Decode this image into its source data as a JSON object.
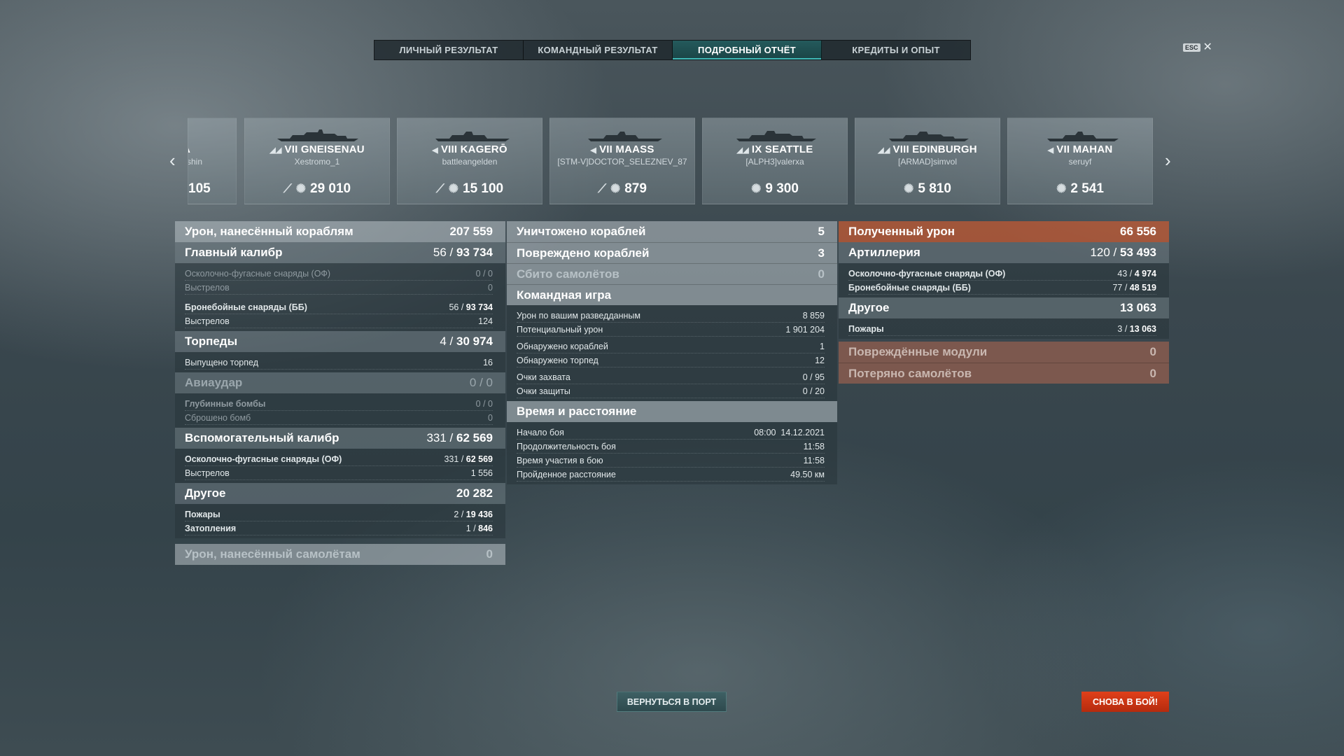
{
  "tabs": [
    "ЛИЧНЫЙ РЕЗУЛЬТАТ",
    "КОМАНДНЫЙ РЕЗУЛЬТАТ",
    "ПОДРОБНЫЙ ОТЧЁТ",
    "КРЕДИТЫ И ОПЫТ"
  ],
  "active_tab": "ПОДРОБНЫЙ ОТЧЁТ",
  "esc_label": "ESC",
  "ships": [
    {
      "name": "A",
      "player": "shin",
      "value": "105",
      "partial": true
    },
    {
      "name": "VII GNEISENAU",
      "player": "Xestromo_1",
      "value": "29 010"
    },
    {
      "name": "VIII KAGERŌ",
      "player": "battleangelden",
      "value": "15 100"
    },
    {
      "name": "VII MAASS",
      "player": "[STM-V]DOCTOR_SELEZNEV_87",
      "value": "879"
    },
    {
      "name": "IX SEATTLE",
      "player": "[ALPH3]valerxa",
      "value": "9 300"
    },
    {
      "name": "VIII EDINBURGH",
      "player": "[ARMAD]simvol",
      "value": "5 810"
    },
    {
      "name": "VII MAHAN",
      "player": "seruyf",
      "value": "2 541"
    }
  ],
  "left": {
    "damage_header": {
      "label": "Урон, нанесённый кораблям",
      "value": "207 559"
    },
    "main_caliber": {
      "label": "Главный калибр",
      "hits": "56",
      "dmg": "93 734"
    },
    "he_shells": {
      "label": "Осколочно-фугасные снаряды (ОФ)",
      "hits": "0",
      "dmg": "0"
    },
    "he_shots": {
      "label": "Выстрелов",
      "value": "0"
    },
    "ap_shells": {
      "label": "Бронебойные снаряды (ББ)",
      "hits": "56",
      "dmg": "93 734"
    },
    "ap_shots": {
      "label": "Выстрелов",
      "value": "124"
    },
    "torpedoes": {
      "label": "Торпеды",
      "hits": "4",
      "dmg": "30 974"
    },
    "torps_launched": {
      "label": "Выпущено торпед",
      "value": "16"
    },
    "airstrike": {
      "label": "Авиаудар",
      "hits": "0",
      "dmg": "0"
    },
    "depth_charges": {
      "label": "Глубинные бомбы",
      "hits": "0",
      "dmg": "0"
    },
    "bombs_dropped": {
      "label": "Сброшено бомб",
      "value": "0"
    },
    "secondary": {
      "label": "Вспомогательный калибр",
      "hits": "331",
      "dmg": "62 569"
    },
    "sec_he": {
      "label": "Осколочно-фугасные снаряды (ОФ)",
      "hits": "331",
      "dmg": "62 569"
    },
    "sec_shots": {
      "label": "Выстрелов",
      "value": "1 556"
    },
    "other": {
      "label": "Другое",
      "value": "20 282"
    },
    "fires": {
      "label": "Пожары",
      "hits": "2",
      "dmg": "19 436"
    },
    "floods": {
      "label": "Затопления",
      "hits": "1",
      "dmg": "846"
    },
    "plane_damage": {
      "label": "Урон, нанесённый самолётам",
      "value": "0"
    }
  },
  "middle": {
    "destroyed": {
      "label": "Уничтожено кораблей",
      "value": "5"
    },
    "damaged": {
      "label": "Повреждено кораблей",
      "value": "3"
    },
    "planes_shot": {
      "label": "Сбито самолётов",
      "value": "0"
    },
    "team_play": {
      "label": "Командная игра"
    },
    "spot_damage": {
      "label": "Урон по вашим разведданным",
      "value": "8 859"
    },
    "potential": {
      "label": "Потенциальный урон",
      "value": "1 901 204"
    },
    "ships_spotted": {
      "label": "Обнаружено кораблей",
      "value": "1"
    },
    "torps_spotted": {
      "label": "Обнаружено торпед",
      "value": "12"
    },
    "capture": {
      "label": "Очки захвата",
      "value": "0 / 95"
    },
    "defense": {
      "label": "Очки защиты",
      "value": "0 / 20"
    },
    "time_dist": {
      "label": "Время и расстояние"
    },
    "battle_start": {
      "label": "Начало боя",
      "value": "08:00  14.12.2021"
    },
    "battle_duration": {
      "label": "Продолжительность боя",
      "value": "11:58"
    },
    "time_in_battle": {
      "label": "Время участия в бою",
      "value": "11:58"
    },
    "distance": {
      "label": "Пройденное расстояние",
      "value": "49.50 км"
    }
  },
  "right": {
    "received": {
      "label": "Полученный урон",
      "value": "66 556"
    },
    "artillery": {
      "label": "Артиллерия",
      "hits": "120",
      "dmg": "53 493"
    },
    "he": {
      "label": "Осколочно-фугасные снаряды (ОФ)",
      "hits": "43",
      "dmg": "4 974"
    },
    "ap": {
      "label": "Бронебойные снаряды (ББ)",
      "hits": "77",
      "dmg": "48 519"
    },
    "other": {
      "label": "Другое",
      "value": "13 063"
    },
    "fires": {
      "label": "Пожары",
      "hits": "3",
      "dmg": "13 063"
    },
    "modules": {
      "label": "Повреждённые модули",
      "value": "0"
    },
    "planes_lost": {
      "label": "Потеряно самолётов",
      "value": "0"
    }
  },
  "buttons": {
    "port": "ВЕРНУТЬСЯ В ПОРТ",
    "battle": "СНОВА В БОЙ!"
  },
  "colors": {
    "accent_teal": "#3fb7b5",
    "battle_red": "#d0361a",
    "received_orange": "#c85a32"
  }
}
